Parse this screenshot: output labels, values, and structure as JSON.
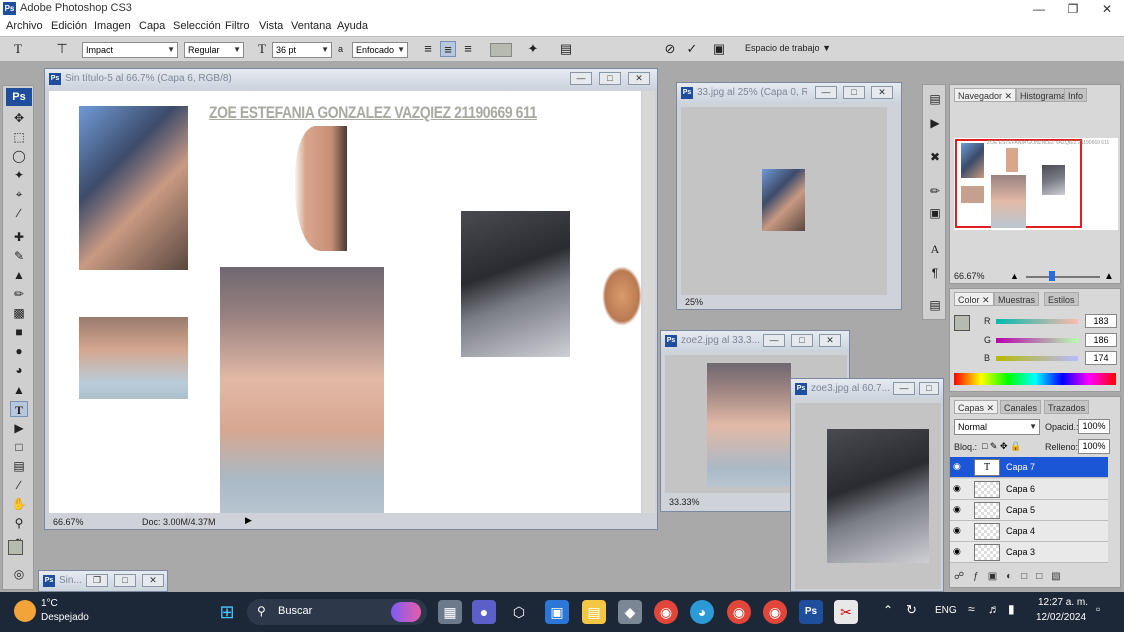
{
  "app": {
    "title": "Adobe Photoshop CS3",
    "logo": "Ps"
  },
  "menu": [
    "Archivo",
    "Edición",
    "Imagen",
    "Capa",
    "Selección",
    "Filtro",
    "Vista",
    "Ventana",
    "Ayuda"
  ],
  "options": {
    "font": "Impact",
    "style": "Regular",
    "size": "36 pt",
    "aa_label": "a",
    "aa": "Enfocado",
    "workspace": "Espacio de trabajo"
  },
  "main_doc": {
    "title": "Sin título-5 al 66.7% (Capa 6, RGB/8)",
    "canvas_text": "ZOE ESTEFANIA GONZALEZ VAZQIEZ 21190669 611",
    "zoom": "66.67%",
    "docsize": "Doc: 3.00M/4.37M"
  },
  "doc2": {
    "title": "33.jpg al 25% (Capa 0, R...",
    "zoom": "25%"
  },
  "doc3": {
    "title": "zoe2.jpg al 33.3...",
    "zoom": "33.33%"
  },
  "doc4": {
    "title": "zoe3.jpg al 60.7..."
  },
  "doc5": {
    "title": "Sin..."
  },
  "navigator": {
    "tabs": [
      "Navegador",
      "Histograma",
      "Info"
    ],
    "zoom": "66.67%",
    "mini_text": "ZOE ESTEFANIA GONZALEZ VAZQIEZ 21190669 611"
  },
  "color": {
    "tabs": [
      "Color",
      "Muestras",
      "Estilos"
    ],
    "r_label": "R",
    "g_label": "G",
    "b_label": "B",
    "r": "183",
    "g": "186",
    "b": "174",
    "fg": "#b7baae"
  },
  "layers": {
    "tabs": [
      "Capas",
      "Canales",
      "Trazados"
    ],
    "blend": "Normal",
    "opacity_label": "Opacid.:",
    "opacity": "100%",
    "lock_label": "Bloq.:",
    "fill_label": "Relleno:",
    "fill": "100%",
    "items": [
      "Capa 7",
      "Capa 6",
      "Capa 5",
      "Capa 4",
      "Capa 3"
    ],
    "text_layer_glyph": "T"
  },
  "taskbar": {
    "weather_temp": "1°C",
    "weather_desc": "Despejado",
    "search": "Buscar",
    "lang": "ENG",
    "time": "12:27 a. m.",
    "date": "12/02/2024",
    "ps_label": "Ps"
  }
}
